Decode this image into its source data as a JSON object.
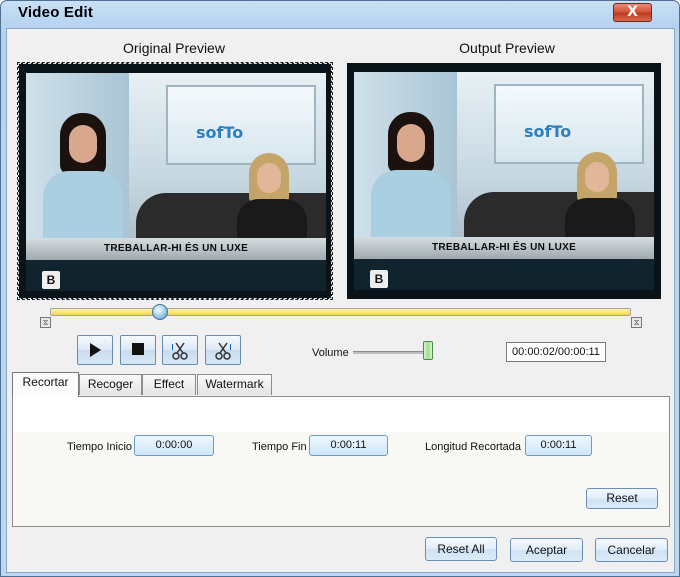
{
  "window": {
    "title": "Video Edit",
    "close_label": "X"
  },
  "preview": {
    "original_label": "Original Preview",
    "output_label": "Output Preview",
    "banner_text": "TREBALLAR-HI ÉS UN LUXE",
    "logo_text": "sofTo",
    "bug_text": "B"
  },
  "timeline": {
    "position_fraction": 0.19
  },
  "controls": {
    "play_icon": "play-icon",
    "stop_icon": "stop-icon",
    "mark_in_icon": "scissors-icon",
    "mark_out_icon": "scissors-icon",
    "volume_label": "Volume",
    "volume_level": 0.95,
    "time_display": "00:00:02/00:00:11"
  },
  "tabs": [
    {
      "label": "Recortar",
      "active": true
    },
    {
      "label": "Recoger",
      "active": false
    },
    {
      "label": "Effect",
      "active": false
    },
    {
      "label": "Watermark",
      "active": false
    }
  ],
  "trim": {
    "start_label": "Tiempo Inicio",
    "start_value": "0:00:00",
    "end_label": "Tiempo Fin",
    "end_value": "0:00:11",
    "length_label": "Longitud Recortada",
    "length_value": "0:00:11",
    "reset_label": "Reset"
  },
  "footer": {
    "reset_all_label": "Reset All",
    "accept_label": "Aceptar",
    "cancel_label": "Cancelar"
  },
  "colors": {
    "title_bar": "#c9e1f6",
    "close_button": "#c13a1f",
    "timeline_fill": "#f2d84a"
  }
}
